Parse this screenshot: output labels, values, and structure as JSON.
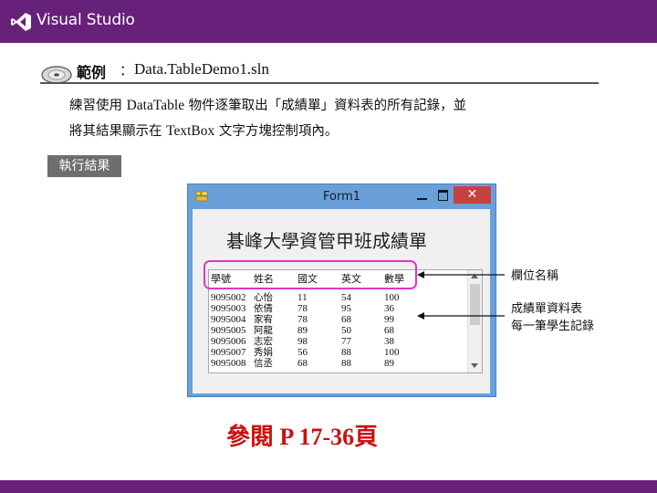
{
  "slide": {
    "brand": "Visual Studio",
    "example_label": "範例",
    "example_colon": "：",
    "example_file": "Data.TableDemo1.sln",
    "description_line1": {
      "a": "練習使用 ",
      "b": "DataTable",
      "c": " 物件逐筆取出「成績單」資料表的所有記錄，並"
    },
    "description_line2": {
      "a": "將其結果顯示在 ",
      "b": "TextBox",
      "c": " 文字方塊控制項內。"
    },
    "result_tag": "執行結果",
    "reference": "參閱 P 17-36頁"
  },
  "window": {
    "title": "Form1",
    "close_glyph": "✕",
    "heading": "碁峰大學資管甲班成績單",
    "columns": [
      "學號",
      "姓名",
      "國文",
      "英文",
      "數學"
    ],
    "records": [
      [
        "9095002",
        "心怡",
        "11",
        "54",
        "100"
      ],
      [
        "9095003",
        "依倩",
        "78",
        "95",
        "36"
      ],
      [
        "9095004",
        "家宥",
        "78",
        "68",
        "99"
      ],
      [
        "9095005",
        "阿龍",
        "89",
        "50",
        "68"
      ],
      [
        "9095006",
        "志宏",
        "98",
        "77",
        "38"
      ],
      [
        "9095007",
        "秀娟",
        "56",
        "88",
        "100"
      ],
      [
        "9095008",
        "信丞",
        "68",
        "88",
        "89"
      ]
    ]
  },
  "annotations": {
    "field_names": "欄位名稱",
    "records_line1": "成績單資料表",
    "records_line2": "每一筆學生記錄"
  },
  "colors": {
    "header_bar": "#68217a",
    "highlight": "#e236c8",
    "reference_text": "#cc1111",
    "window_frame": "#6aa0da",
    "close_button": "#c7413f"
  },
  "icons": [
    "visual-studio-logo-icon",
    "cd-disc-icon",
    "form-app-icon",
    "minimize-icon",
    "maximize-icon",
    "close-icon",
    "scroll-up-icon",
    "scroll-down-icon",
    "arrow-left-icon"
  ]
}
